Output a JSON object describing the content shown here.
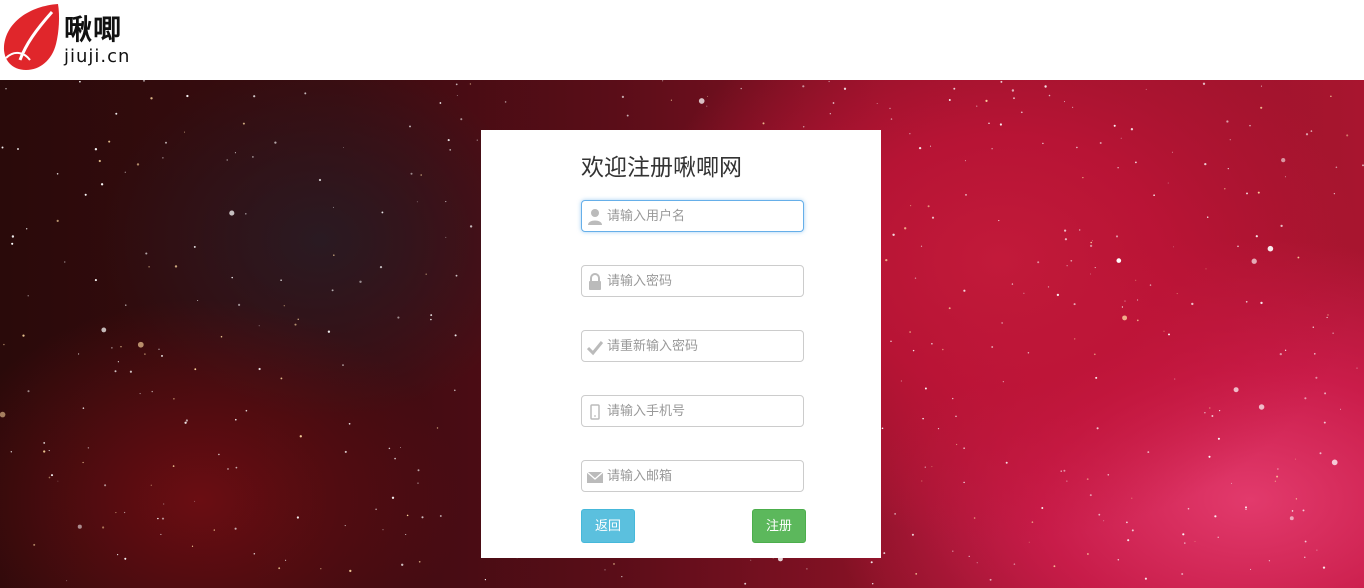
{
  "header": {
    "logo_cn": "啾唧",
    "logo_domain": "jiuji.cn",
    "logo_icon": "red-leaf-icon"
  },
  "form": {
    "title": "欢迎注册啾唧网",
    "fields": [
      {
        "name": "username",
        "placeholder": "请输入用户名",
        "icon": "user-icon",
        "value": ""
      },
      {
        "name": "password",
        "placeholder": "请输入密码",
        "icon": "lock-icon",
        "value": ""
      },
      {
        "name": "confirm_password",
        "placeholder": "请重新输入密码",
        "icon": "check-icon",
        "value": ""
      },
      {
        "name": "phone",
        "placeholder": "请输入手机号",
        "icon": "phone-icon",
        "value": ""
      },
      {
        "name": "email",
        "placeholder": "请输入邮箱",
        "icon": "envelope-icon",
        "value": ""
      }
    ],
    "back_label": "返回",
    "register_label": "注册"
  },
  "colors": {
    "brand_red": "#e0262b",
    "focus_border": "#66afe9",
    "back_button": "#5bc0de",
    "register_button": "#5cb85c"
  }
}
